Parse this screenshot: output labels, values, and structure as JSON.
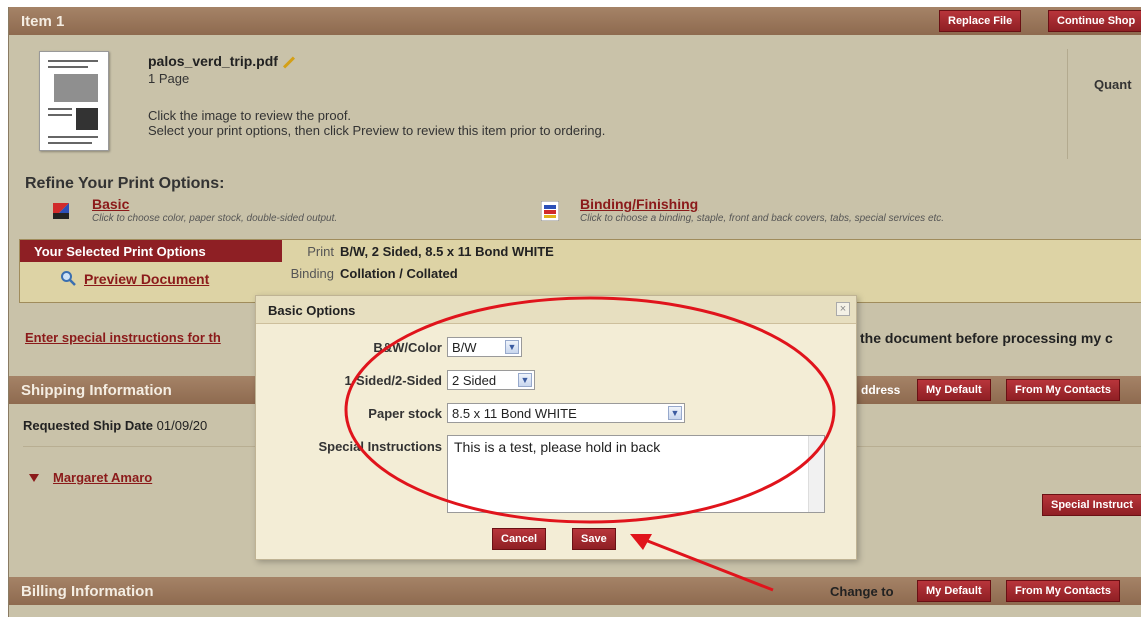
{
  "item": {
    "title": "Item 1",
    "replace_file": "Replace File",
    "continue_shopping": "Continue Shop",
    "filename": "palos_verd_trip.pdf",
    "pages": "1 Page",
    "hint_line1": "Click the image to review the proof.",
    "hint_line2": "Select your print options, then click Preview to review this item prior to ordering.",
    "quantity_label": "Quant"
  },
  "refine": {
    "heading": "Refine Your Print Options:",
    "basic_title": "Basic",
    "basic_desc": "Click to choose color, paper stock, double-sided output.",
    "binding_title": "Binding/Finishing",
    "binding_desc": "Click to choose a binding, staple, front and back covers, tabs, special services etc."
  },
  "selected": {
    "tab": "Your Selected Print Options",
    "preview": "Preview Document",
    "print_label": "Print",
    "print_value": "B/W, 2 Sided, 8.5 x 11 Bond WHITE",
    "binding_label": "Binding",
    "binding_value": "Collation / Collated"
  },
  "instructions": {
    "link": "Enter special instructions for th",
    "right_text": "the document before processing my c"
  },
  "shipping": {
    "title": "Shipping Information",
    "address_label": "ddress",
    "my_default": "My Default",
    "from_contacts": "From My Contacts",
    "req_label": "Requested Ship Date",
    "req_value": "01/09/20",
    "contact": "Margaret Amaro",
    "special_btn": "Special Instruct"
  },
  "billing": {
    "title": "Billing Information",
    "change_to": "Change to",
    "my_default": "My Default",
    "from_contacts": "From My Contacts"
  },
  "modal": {
    "title": "Basic Options",
    "close": "×",
    "color_label": "B&W/Color",
    "color_value": "B/W",
    "sided_label": "1-Sided/2-Sided",
    "sided_value": "2 Sided",
    "paper_label": "Paper stock",
    "paper_value": "8.5 x 11 Bond WHITE",
    "instructions_label": "Special Instructions",
    "instructions_value": "This is a test, please hold in back",
    "cancel": "Cancel",
    "save": "Save"
  },
  "colors": {
    "brand_red": "#8e1f24",
    "band_brown": "#9a7559",
    "page_bg": "#c9c2a9",
    "annotation_red": "#e0141c"
  }
}
